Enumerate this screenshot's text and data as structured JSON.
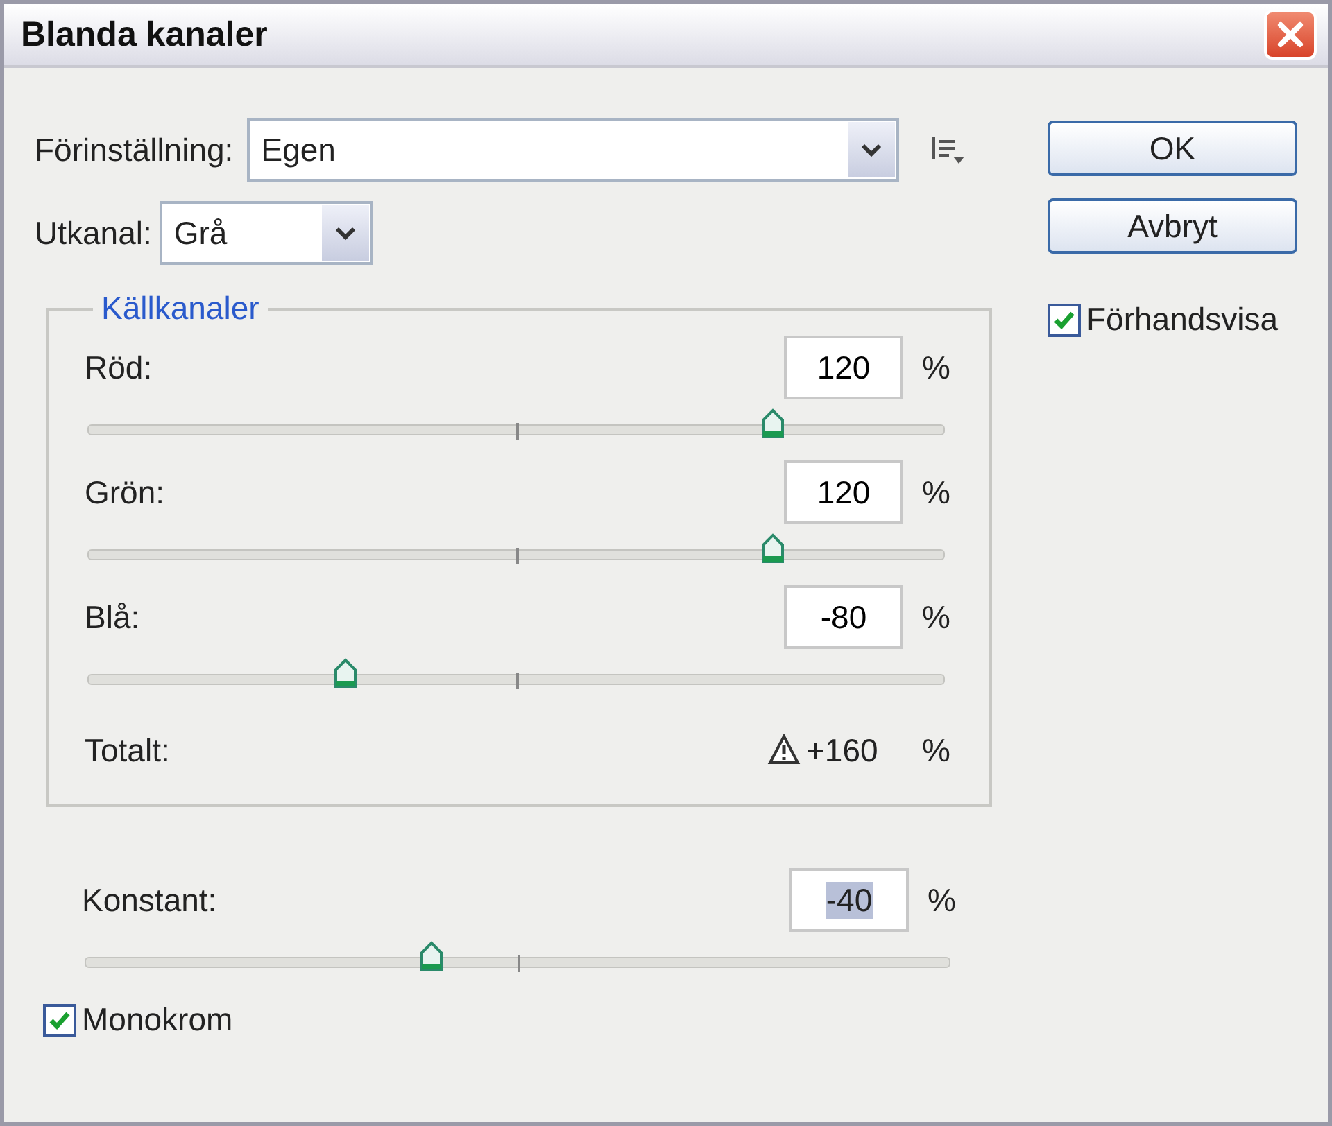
{
  "window": {
    "title": "Blanda kanaler"
  },
  "preset": {
    "label": "Förinställning:",
    "value": "Egen"
  },
  "output_channel": {
    "label": "Utkanal:",
    "value": "Grå"
  },
  "source_channels": {
    "title": "Källkanaler",
    "channels": [
      {
        "label": "Röd:",
        "value": "120",
        "unit": "%",
        "level": 0.8
      },
      {
        "label": "Grön:",
        "value": "120",
        "unit": "%",
        "level": 0.8
      },
      {
        "label": "Blå:",
        "value": "-80",
        "unit": "%",
        "level": 0.3
      }
    ],
    "total": {
      "label": "Totalt:",
      "value": "+160",
      "unit": "%",
      "warning": true
    }
  },
  "constant": {
    "label": "Konstant:",
    "value": "-40",
    "unit": "%",
    "level": 0.4,
    "highlighted": true
  },
  "monochrome": {
    "label": "Monokrom",
    "checked": true
  },
  "buttons": [
    {
      "label": "OK"
    },
    {
      "label": "Avbryt"
    }
  ],
  "preview": {
    "label": "Förhandsvisa",
    "checked": true
  }
}
